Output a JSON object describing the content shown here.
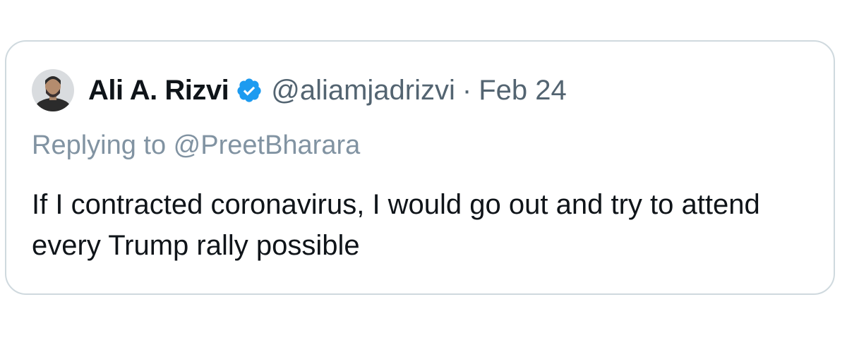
{
  "tweet": {
    "display_name": "Ali A. Rizvi",
    "handle": "@aliamjadrizvi",
    "separator": "·",
    "date": "Feb 24",
    "reply_prefix": "Replying to ",
    "reply_to": "@PreetBharara",
    "text": "If I contracted coronavirus, I would go out and try to attend every Trump rally possible",
    "verified": true,
    "verified_icon": "verified-badge-icon",
    "avatar_icon": "avatar"
  },
  "colors": {
    "border": "#cfd9de",
    "name": "#0f1419",
    "secondary": "#536471",
    "verified": "#1d9bf0"
  }
}
